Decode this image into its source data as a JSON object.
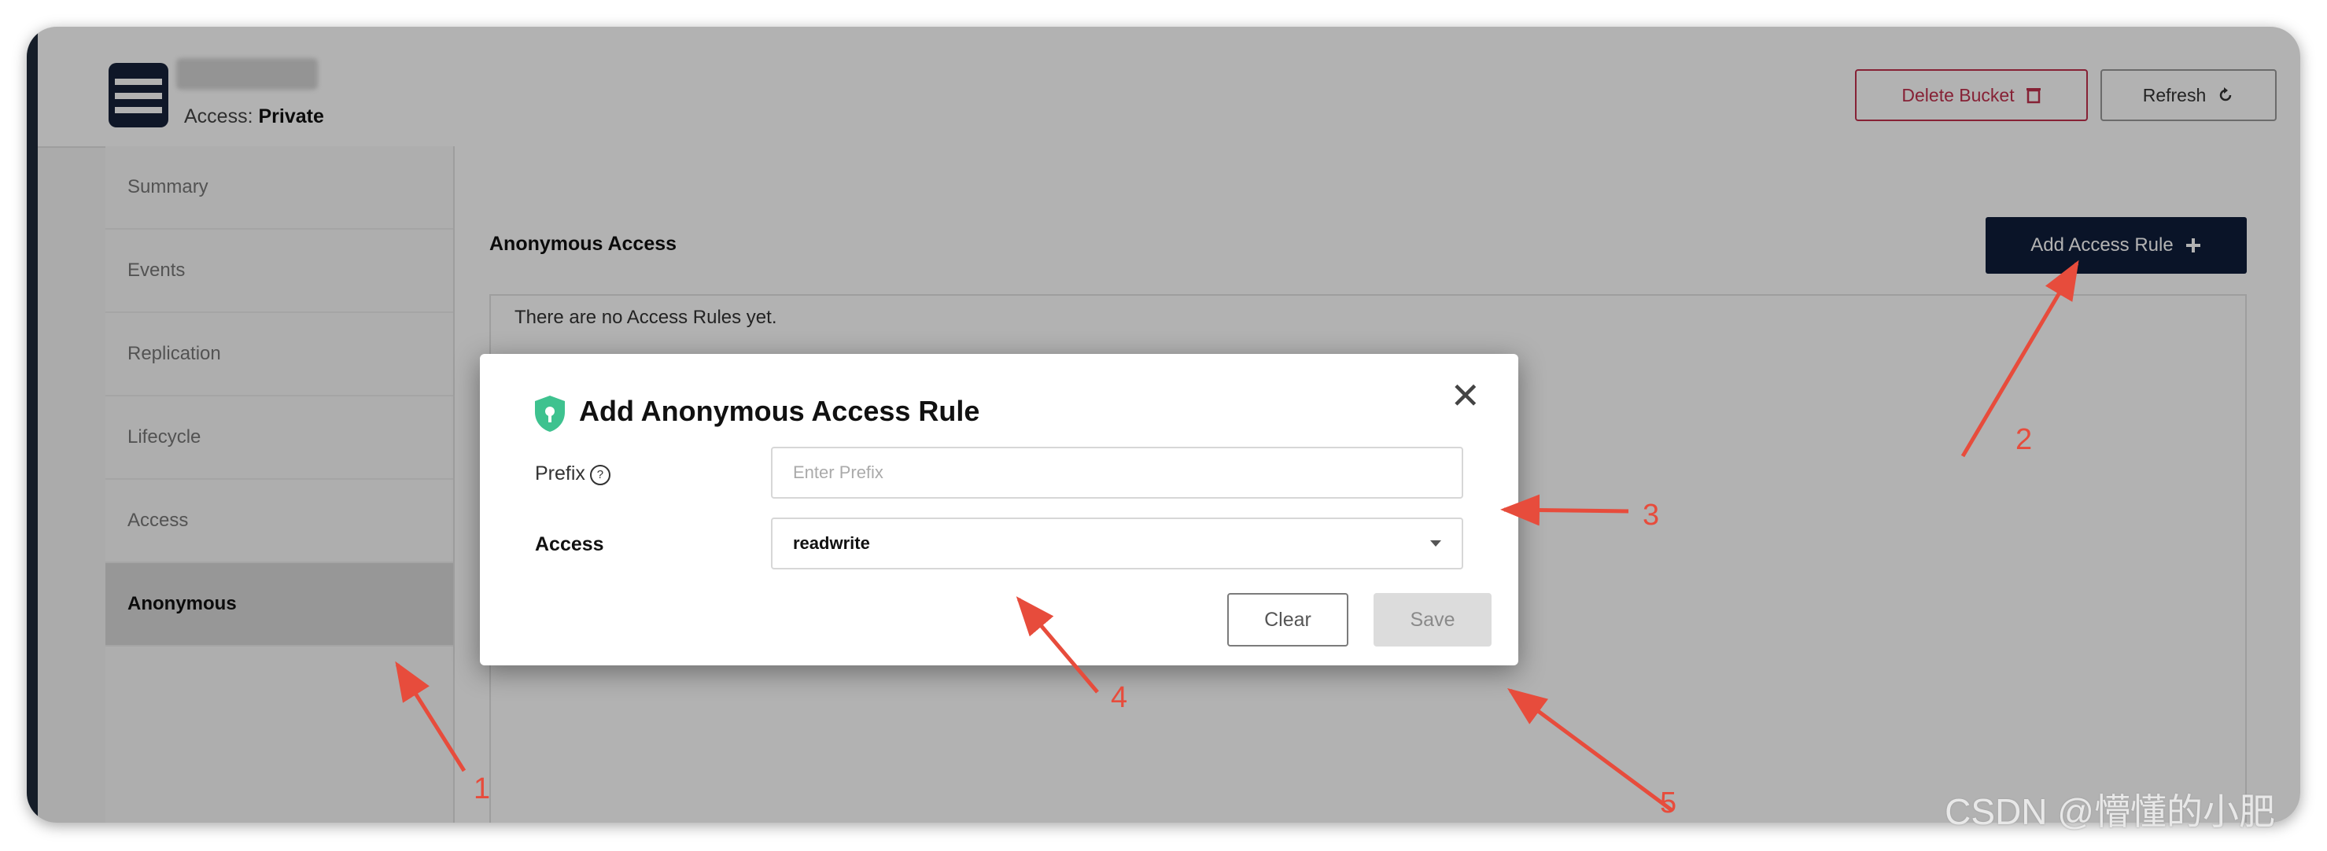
{
  "header": {
    "access_label": "Access:",
    "access_value": "Private",
    "delete_button": "Delete Bucket",
    "refresh_button": "Refresh"
  },
  "sidebar": {
    "items": [
      {
        "label": "Summary"
      },
      {
        "label": "Events"
      },
      {
        "label": "Replication"
      },
      {
        "label": "Lifecycle"
      },
      {
        "label": "Access"
      },
      {
        "label": "Anonymous",
        "active": true
      }
    ]
  },
  "main": {
    "section_title": "Anonymous Access",
    "add_button": "Add Access Rule",
    "empty_message": "There are no Access Rules yet."
  },
  "modal": {
    "title": "Add Anonymous Access Rule",
    "prefix_label": "Prefix",
    "prefix_placeholder": "Enter Prefix",
    "access_label": "Access",
    "access_value": "readwrite",
    "clear_button": "Clear",
    "save_button": "Save"
  },
  "annotations": {
    "callouts": [
      "1",
      "2",
      "3",
      "4",
      "5"
    ],
    "color": "#e74c3c"
  },
  "watermark": "CSDN @懵懂的小肥",
  "colors": {
    "primary_dark": "#0f1d3a",
    "danger": "#c0304d",
    "shield_green": "#3ec28f"
  }
}
